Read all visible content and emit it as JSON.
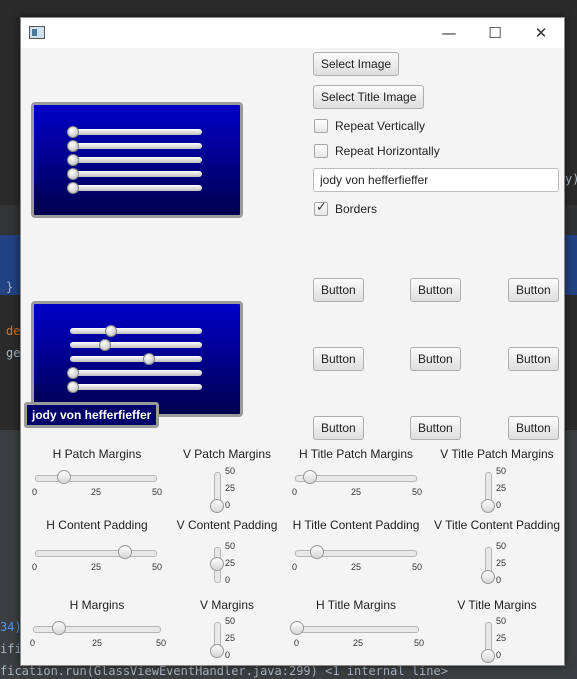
{
  "background": {
    "ide_fragments": [
      "y).",
      "}",
      "de",
      "ge",
      "34)",
      "ifi",
      "fication.run(GlassViewEventHandler.java:299) <1 internal line>"
    ]
  },
  "window": {
    "controls": {
      "minimize": "—",
      "maximize": "☐",
      "close": "✕"
    }
  },
  "buttons": {
    "select_image": "Select Image",
    "select_title_image": "Select Title Image",
    "grid": [
      "Button",
      "Button",
      "Button",
      "Button",
      "Button",
      "Button",
      "Button",
      "Button",
      "Button"
    ]
  },
  "checkboxes": {
    "repeat_vertically": {
      "label": "Repeat Vertically",
      "checked": false
    },
    "repeat_horizontally": {
      "label": "Repeat Horizontally",
      "checked": false
    },
    "borders": {
      "label": "Borders",
      "checked": true
    }
  },
  "title_field": {
    "value": "jody von hefferfieffer"
  },
  "title_label": "jody von hefferfieffer",
  "panel1": {
    "slider_values": [
      0,
      0,
      0,
      0,
      0
    ]
  },
  "panel2": {
    "slider_values": [
      30,
      25,
      60,
      0,
      0
    ]
  },
  "sliders": {
    "h_patch_margins": {
      "label": "H Patch Margins",
      "value": 12,
      "min": 0,
      "max": 50,
      "ticks": [
        "0",
        "25",
        "50"
      ]
    },
    "v_patch_margins": {
      "label": "V Patch Margins",
      "value": 0,
      "min": 0,
      "max": 50,
      "ticks": [
        "50",
        "25",
        "0"
      ]
    },
    "h_title_patch_margins": {
      "label": "H Title Patch Margins",
      "value": 6,
      "min": 0,
      "max": 50,
      "ticks": [
        "0",
        "25",
        "50"
      ]
    },
    "v_title_patch_margins": {
      "label": "V Title Patch Margins",
      "value": 0,
      "min": 0,
      "max": 50,
      "ticks": [
        "50",
        "25",
        "0"
      ]
    },
    "h_content_padding": {
      "label": "H Content Padding",
      "value": 37,
      "min": 0,
      "max": 50,
      "ticks": [
        "0",
        "25",
        "50"
      ]
    },
    "v_content_padding": {
      "label": "V Content Padding",
      "value": 25,
      "min": 0,
      "max": 50,
      "ticks": [
        "50",
        "25",
        "0"
      ]
    },
    "h_title_content_padding": {
      "label": "H Title Content Padding",
      "value": 9,
      "min": 0,
      "max": 50,
      "ticks": [
        "0",
        "25",
        "50"
      ]
    },
    "v_title_content_padding": {
      "label": "V Title Content Padding",
      "value": 6,
      "min": 0,
      "max": 50,
      "ticks": [
        "50",
        "25",
        "0"
      ]
    },
    "h_margins": {
      "label": "H Margins",
      "value": 10,
      "min": 0,
      "max": 50,
      "ticks": [
        "0",
        "25",
        "50"
      ]
    },
    "v_margins": {
      "label": "V Margins",
      "value": 8,
      "min": 0,
      "max": 50,
      "ticks": [
        "50",
        "25",
        "0"
      ]
    },
    "h_title_margins": {
      "label": "H Title Margins",
      "value": 0,
      "min": 0,
      "max": 50,
      "ticks": [
        "0",
        "25",
        "50"
      ]
    },
    "v_title_margins": {
      "label": "V Title Margins",
      "value": 0,
      "min": 0,
      "max": 50,
      "ticks": [
        "50",
        "25",
        "0"
      ]
    }
  }
}
